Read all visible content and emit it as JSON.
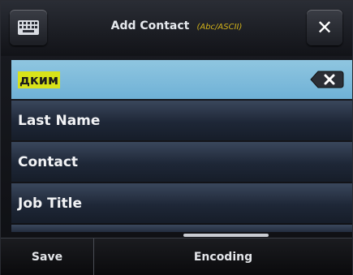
{
  "header": {
    "title": "Add Contact",
    "subtitle": "(Abc/ASCII)",
    "keyboard_icon": "keyboard-icon",
    "close_label": "✕"
  },
  "fields": [
    {
      "value": "дким",
      "active": true
    },
    {
      "label": "Last Name"
    },
    {
      "label": "Contact"
    },
    {
      "label": "Job Title"
    }
  ],
  "softkeys": {
    "save": "Save",
    "encoding": "Encoding"
  },
  "colors": {
    "active_row": "#7ab8dc",
    "highlight": "#d8e21a",
    "subtitle": "#d4b31a"
  }
}
